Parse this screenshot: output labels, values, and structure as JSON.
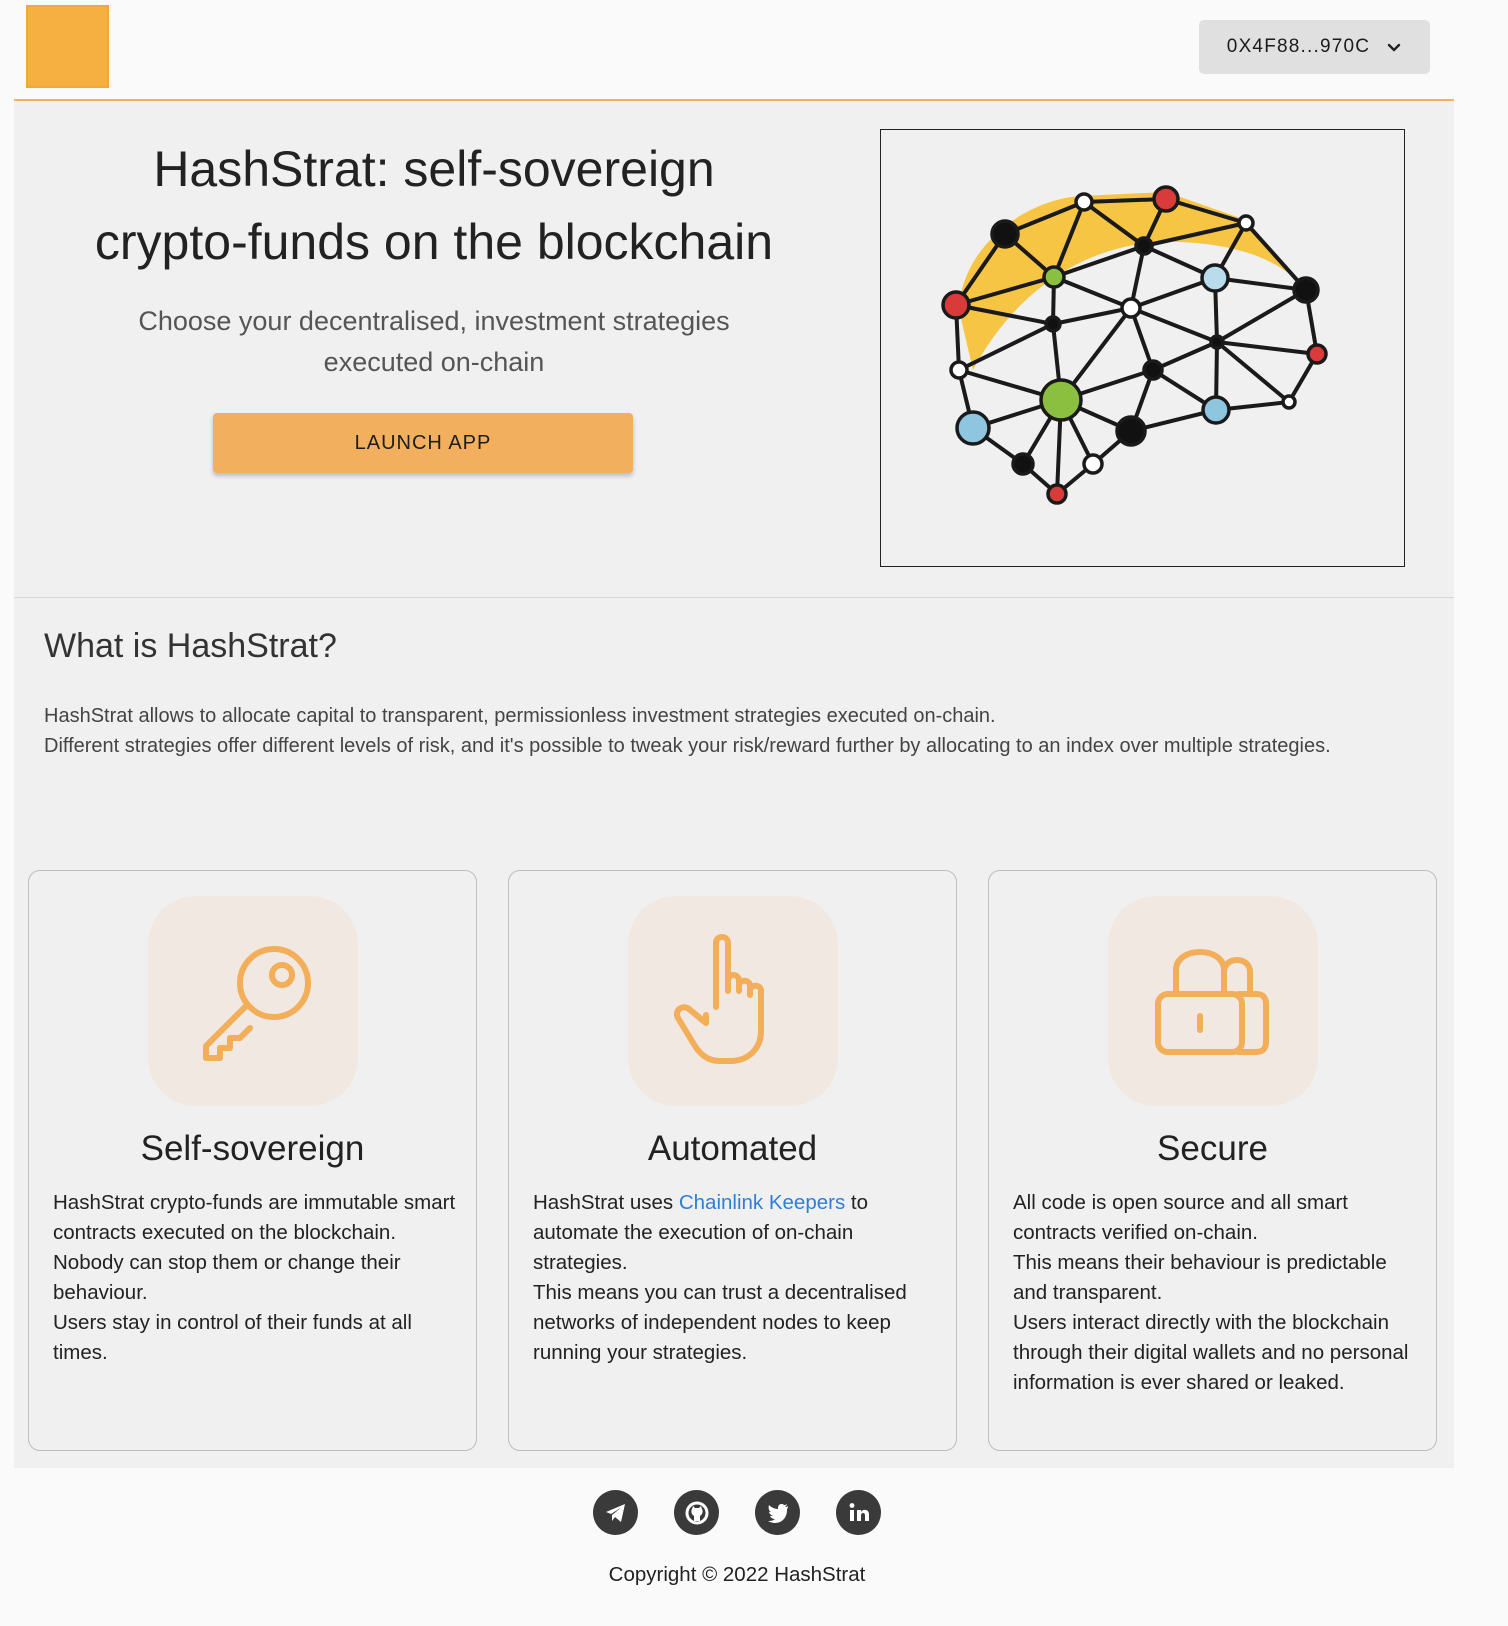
{
  "header": {
    "logo_icon": "logo-square",
    "wallet_address": "0X4F88...970C",
    "wallet_chevron_icon": "chevron-down-icon"
  },
  "hero": {
    "title_line1": "HashStrat: self-sovereign",
    "title_line2": "crypto-funds on the blockchain",
    "subtitle_line1": "Choose your decentralised, investment strategies",
    "subtitle_line2": "executed on-chain",
    "launch_label": "LAUNCH APP",
    "illustration": "brain-network-illustration"
  },
  "about": {
    "heading": "What is HashStrat?",
    "line1": "HashStrat allows to allocate capital to transparent, permissionless investment strategies executed on-chain.",
    "line2": "Different strategies offer different levels of risk, and it's possible to tweak your risk/reward further by allocating to an index over multiple strategies."
  },
  "features": [
    {
      "icon": "key-icon",
      "title": "Self-sovereign",
      "lines": [
        "HashStrat crypto-funds are immutable smart contracts executed on the blockchain.",
        "Nobody can stop them or change their behaviour.",
        "Users stay in control of their funds at all times."
      ]
    },
    {
      "icon": "pointer-hand-icon",
      "title": "Automated",
      "text_before_link": "HashStrat uses ",
      "link_text": "Chainlink Keepers",
      "text_after_link": " to automate the execution of on-chain strategies.",
      "line2": "This means you can trust a decentralised networks of independent nodes to keep running your strategies."
    },
    {
      "icon": "lock-icon",
      "title": "Secure",
      "lines": [
        "All code is open source and all smart contracts verified on-chain.",
        "This means their behaviour is predictable and transparent.",
        "Users interact directly with the blockchain through their digital wallets and no personal information is ever shared or leaked."
      ]
    }
  ],
  "footer": {
    "social_icons": [
      "telegram-icon",
      "github-icon",
      "twitter-icon",
      "linkedin-icon"
    ],
    "copyright": "Copyright © 2022 HashStrat"
  },
  "colors": {
    "accent": "#f2b05e",
    "logo": "#f5b041",
    "link": "#2f7fd6",
    "icon_bg": "#f1e8e1",
    "footer_icon": "#3a3a3a"
  }
}
